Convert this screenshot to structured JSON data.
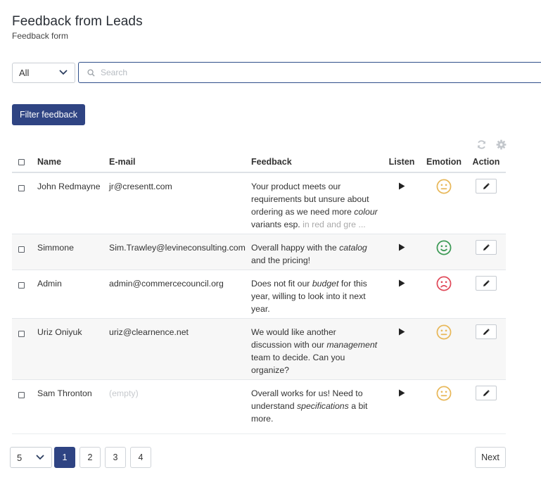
{
  "header": {
    "title": "Feedback from Leads",
    "subtitle": "Feedback form"
  },
  "filters": {
    "scope_select": "All",
    "search_placeholder": "Search",
    "filter_button": "Filter feedback"
  },
  "table": {
    "columns": [
      "Name",
      "E-mail",
      "Feedback",
      "Listen",
      "Emotion",
      "Action"
    ],
    "rows": [
      {
        "name": "John Redmayne",
        "email": "jr@cresentt.com",
        "feedback_parts": [
          {
            "text": "Your product meets our requirements but unsure about ordering as we need more "
          },
          {
            "text": "colour",
            "em": true
          },
          {
            "text": " variants esp. "
          },
          {
            "text": "in red and gre ...",
            "fade": true
          }
        ],
        "emotion": "neutral"
      },
      {
        "name": "Simmone",
        "email": "Sim.Trawley@levineconsulting.com",
        "feedback_parts": [
          {
            "text": "Overall happy with the "
          },
          {
            "text": "catalog",
            "em": true
          },
          {
            "text": " and the pricing!"
          }
        ],
        "emotion": "happy"
      },
      {
        "name": "Admin",
        "email": "admin@commercecouncil.org",
        "feedback_parts": [
          {
            "text": "Does not fit our "
          },
          {
            "text": "budget",
            "em": true
          },
          {
            "text": " for this year, willing to look into it next year."
          }
        ],
        "emotion": "sad"
      },
      {
        "name": "Uriz Oniyuk",
        "email": "uriz@clearnence.net",
        "feedback_parts": [
          {
            "text": "We would like another discussion with our "
          },
          {
            "text": "management",
            "em": true
          },
          {
            "text": " team to decide. Can you organize?"
          }
        ],
        "emotion": "neutral"
      },
      {
        "name": "Sam Thronton",
        "email": "(empty)",
        "email_empty": true,
        "feedback_parts": [
          {
            "text": "Overall works for us! Need to understand "
          },
          {
            "text": "specifications",
            "em": true
          },
          {
            "text": " a bit more."
          }
        ],
        "emotion": "neutral"
      }
    ]
  },
  "pagination": {
    "page_size": "5",
    "pages": [
      "1",
      "2",
      "3",
      "4"
    ],
    "current_page": "1",
    "next_label": "Next"
  },
  "icons": {
    "search": "search-icon",
    "refresh": "refresh-icon",
    "settings": "gear-icon",
    "listen": "play-icon",
    "edit": "pencil-icon",
    "dropdown": "chevron-down-icon"
  },
  "colors": {
    "primary": "#2f4483",
    "emotion_neutral": "#e8b85a",
    "emotion_happy": "#3d9a56",
    "emotion_sad": "#e04a5a"
  }
}
